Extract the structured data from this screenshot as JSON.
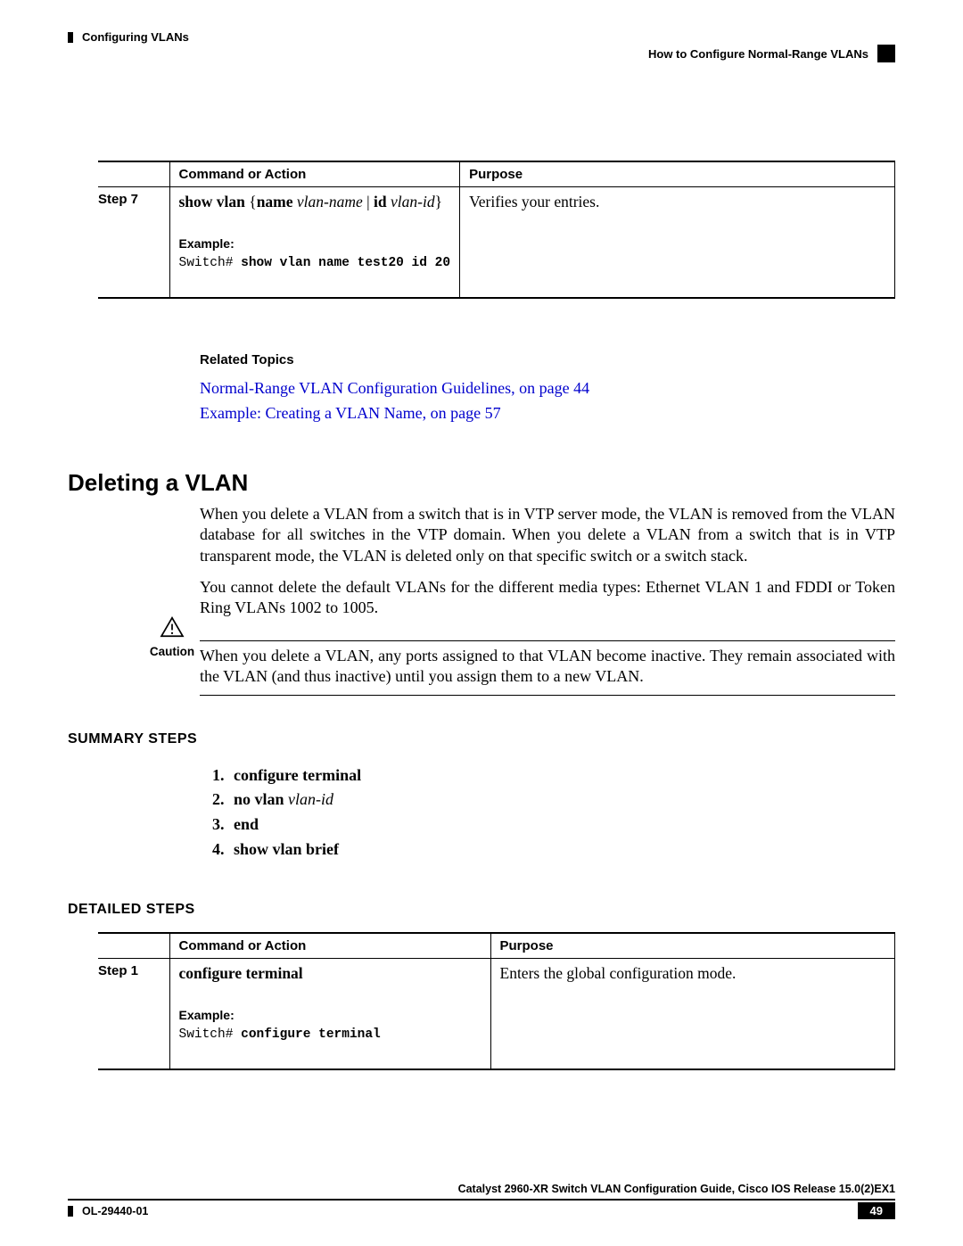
{
  "header": {
    "left": "Configuring VLANs",
    "right": "How to Configure Normal-Range VLANs"
  },
  "table1": {
    "head_step": "",
    "head_command": "Command or Action",
    "head_purpose": "Purpose",
    "row": {
      "step": "Step 7",
      "command_html": "show vlan {name <i>vlan-name</i> | id <i>vlan-id</i>}",
      "example_label": "Example:",
      "example_prefix": "Switch# ",
      "example_cmd": "show vlan name test20 id 20",
      "purpose": "Verifies your entries."
    }
  },
  "related": {
    "title": "Related Topics",
    "link1": "Normal-Range VLAN Configuration Guidelines,  on page 44",
    "link2": "Example: Creating a VLAN Name,  on page 57"
  },
  "section": {
    "title": "Deleting a VLAN",
    "para1": "When you delete a VLAN from a switch that is in VTP server mode, the VLAN is removed from the VLAN database for all switches in the VTP domain. When you delete a VLAN from a switch that is in VTP transparent mode, the VLAN is deleted only on that specific switch or a switch stack.",
    "para2": "You cannot delete the default VLANs for the different media types: Ethernet VLAN 1 and FDDI or Token Ring VLANs 1002 to 1005."
  },
  "caution": {
    "label": "Caution",
    "text": "When you delete a VLAN, any ports assigned to that VLAN become inactive. They remain associated with the VLAN (and thus inactive) until you assign them to a new VLAN."
  },
  "summary": {
    "heading": "SUMMARY STEPS",
    "items": [
      {
        "num": "1.",
        "bold": "configure terminal",
        "ital": ""
      },
      {
        "num": "2.",
        "bold": "no vlan",
        "ital": " vlan-id"
      },
      {
        "num": "3.",
        "bold": "end",
        "ital": ""
      },
      {
        "num": "4.",
        "bold": "show vlan brief",
        "ital": ""
      }
    ]
  },
  "detailed": {
    "heading": "DETAILED STEPS"
  },
  "table2": {
    "head_step": "",
    "head_command": "Command or Action",
    "head_purpose": "Purpose",
    "row": {
      "step": "Step 1",
      "command": "configure terminal",
      "example_label": "Example:",
      "example_prefix": "Switch# ",
      "example_cmd": "configure terminal",
      "purpose": "Enters the global configuration mode."
    }
  },
  "footer": {
    "line1": "Catalyst 2960-XR Switch VLAN Configuration Guide, Cisco IOS Release 15.0(2)EX1",
    "ol": "OL-29440-01",
    "page": "49"
  }
}
